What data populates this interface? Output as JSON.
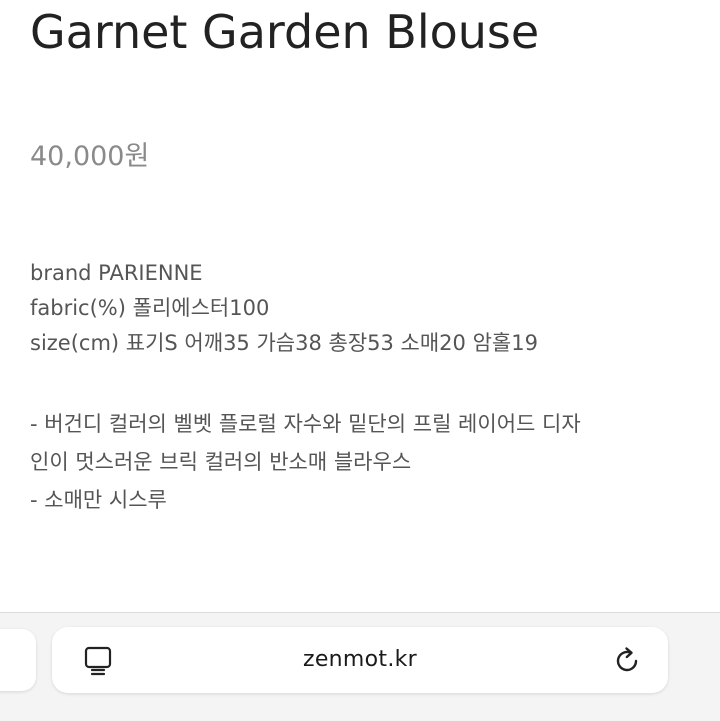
{
  "product": {
    "title": "Garnet Garden Blouse",
    "price": "40,000원"
  },
  "details": {
    "brand": "brand PARIENNE",
    "fabric": "fabric(%) 폴리에스터100",
    "size": "size(cm) 표기S 어깨35 가슴38 총장53 소매20 암홀19"
  },
  "description": [
    "- 버건디 컬러의 벨벳 플로럴 자수와 밑단의 프릴 레이어드 디자",
    "인이 멋스러운 브릭 컬러의 반소매 블라우스",
    "- 소매만 시스루"
  ],
  "browser": {
    "url": "zenmot.kr",
    "icons": {
      "reader": "reader-mode-icon",
      "reload": "reload-icon"
    }
  }
}
